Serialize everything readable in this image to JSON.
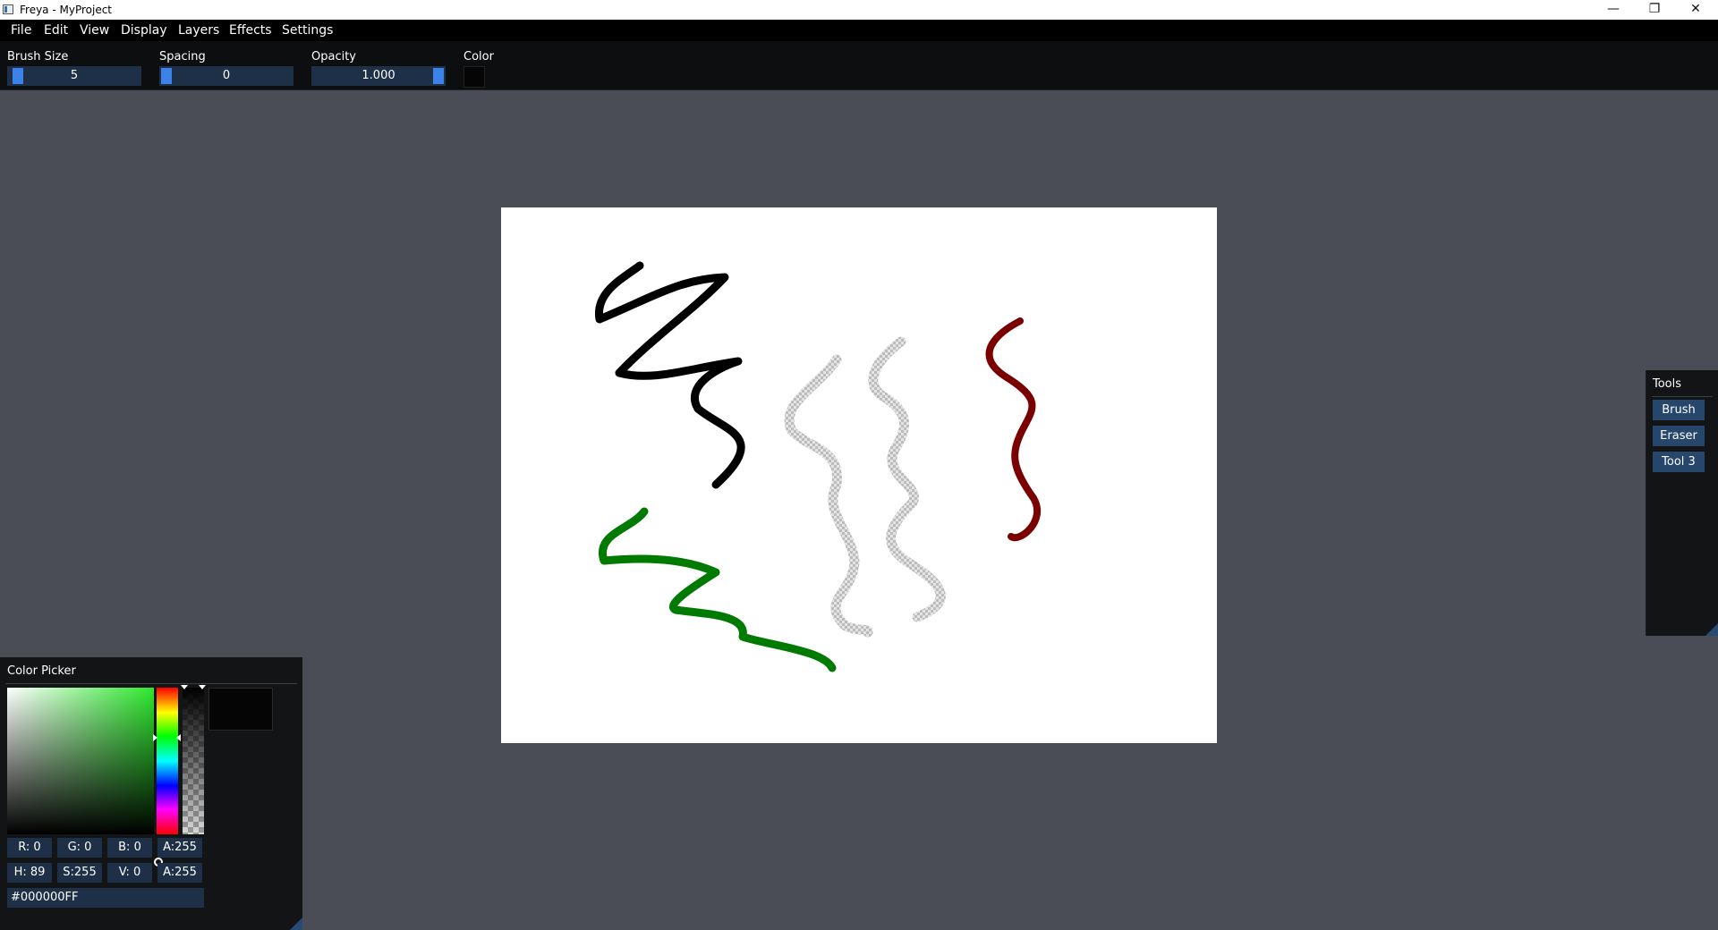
{
  "window": {
    "title": "Freya - MyProject",
    "minimize_glyph": "—",
    "maximize_glyph": "❐",
    "close_glyph": "✕"
  },
  "menu": [
    "File",
    "Edit",
    "View",
    "Display",
    "Layers",
    "Effects",
    "Settings"
  ],
  "toolbar": {
    "brush_size_label": "Brush Size",
    "brush_size_value": "5",
    "spacing_label": "Spacing",
    "spacing_value": "0",
    "opacity_label": "Opacity",
    "opacity_value": "1.000",
    "color_label": "Color",
    "color_value": "#000000"
  },
  "canvas": {
    "background": "#FFFFFF",
    "stroke_colors": {
      "black": "#000000",
      "green": "#007A00",
      "dark_red": "#7A0000",
      "erased": "transparent"
    }
  },
  "tools_panel": {
    "title": "Tools",
    "buttons": [
      "Brush",
      "Eraser",
      "Tool 3"
    ]
  },
  "color_picker": {
    "title": "Color Picker",
    "fields_rgba": {
      "r": "R: 0",
      "g": "G: 0",
      "b": "B: 0",
      "a": "A:255"
    },
    "fields_hsva": {
      "h": "H: 89",
      "s": "S:255",
      "v": "V: 0",
      "a": "A:255"
    },
    "hex": "#000000FF",
    "hue_color": "#2EE82E"
  },
  "colors": {
    "app_bg": "#4A4D55",
    "panel_bg": "#121416",
    "field_bg": "#1D3048",
    "accent": "#3D82E8",
    "button_bg": "#26466C"
  }
}
